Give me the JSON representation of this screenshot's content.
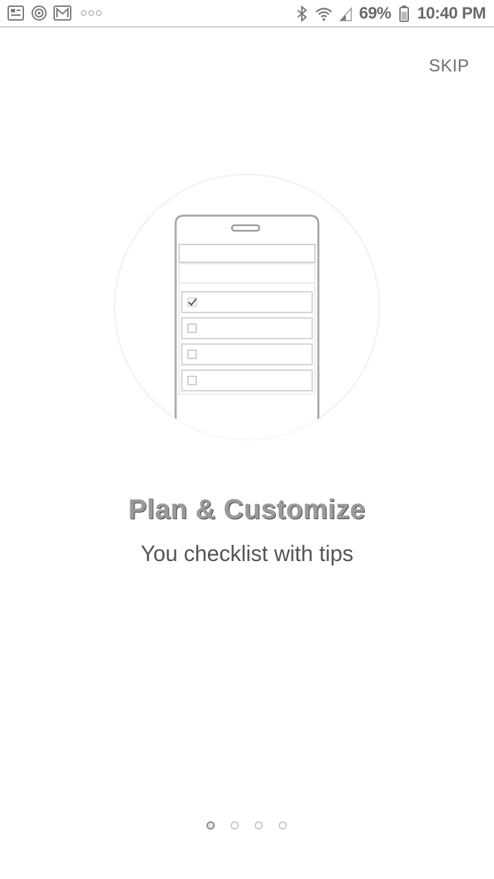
{
  "status_bar": {
    "left_icons": [
      "image-notification-icon",
      "target-notification-icon",
      "email-notification-icon",
      "more-notifications-icon"
    ],
    "right_icons": [
      "bluetooth-icon",
      "wifi-icon",
      "signal-icon",
      "battery-icon"
    ],
    "battery": "69%",
    "time": "10:40 PM"
  },
  "header": {
    "skip_label": "SKIP"
  },
  "onboarding": {
    "title": "Plan & Customize",
    "subtitle": "You checklist with tips",
    "checklist_items": [
      {
        "checked": true
      },
      {
        "checked": false
      },
      {
        "checked": false
      },
      {
        "checked": false
      }
    ]
  },
  "pager": {
    "count": 4,
    "active_index": 0
  }
}
